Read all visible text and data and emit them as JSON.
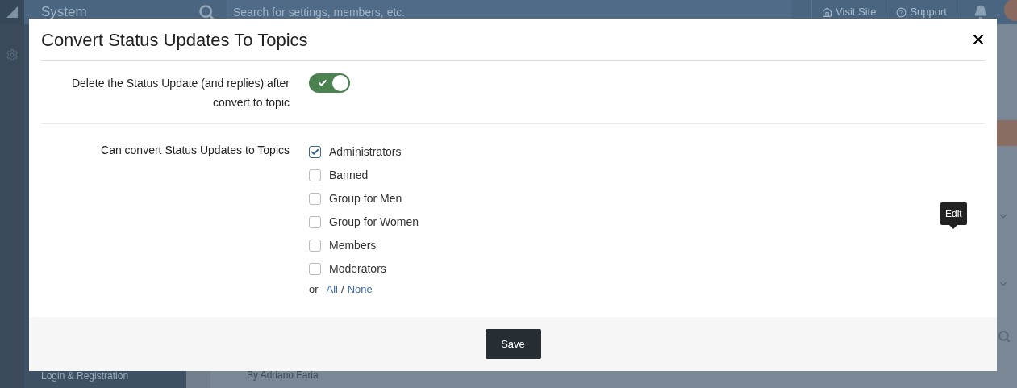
{
  "background": {
    "sidebar_title": "System",
    "search_placeholder": "Search for settings, members, etc.",
    "top_links": [
      "Visit Site",
      "Support"
    ],
    "sidebar_item": "Login & Registration",
    "author": "By Adriano Faria"
  },
  "dialog": {
    "title": "Convert Status Updates To Topics",
    "fields": [
      {
        "kind": "toggle",
        "label": "Delete the Status Update (and replies) after convert to topic",
        "on": true
      },
      {
        "kind": "checklist",
        "label": "Can convert Status Updates to Topics",
        "options": [
          {
            "label": "Administrators",
            "checked": true
          },
          {
            "label": "Banned",
            "checked": false
          },
          {
            "label": "Group for Men",
            "checked": false
          },
          {
            "label": "Group for Women",
            "checked": false
          },
          {
            "label": "Members",
            "checked": false
          },
          {
            "label": "Moderators",
            "checked": false
          }
        ],
        "or": "or",
        "all": "All",
        "separator": "/",
        "none": "None"
      }
    ],
    "save": "Save"
  },
  "tooltip": "Edit"
}
